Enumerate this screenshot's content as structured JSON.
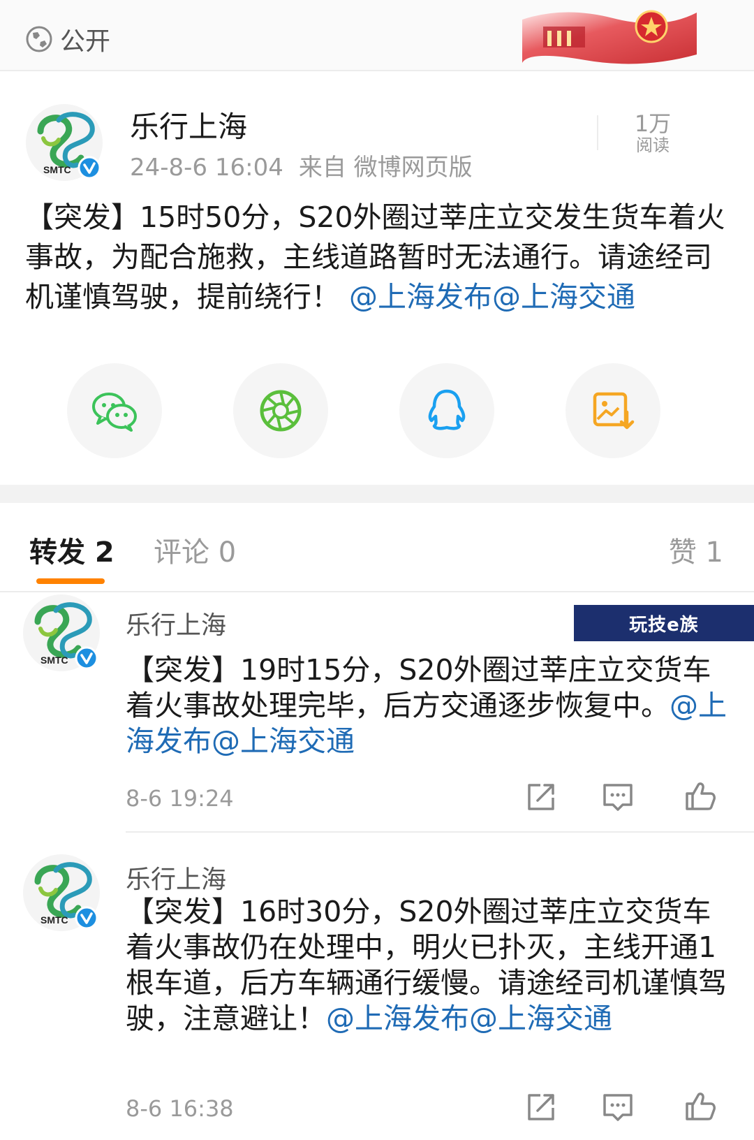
{
  "header": {
    "visibility_label": "公开",
    "visibility_icon": "globe-icon"
  },
  "post": {
    "author": "乐行上海",
    "avatar_text": "SMTC",
    "timestamp": "24-8-6 16:04",
    "source": "来自 微博网页版",
    "reads_count": "1万",
    "reads_label": "阅读",
    "text": "【突发】15时50分，S20外圈过莘庄立交发生货车着火事故，为配合施救，主线道路暂时无法通行。请途经司机谨慎驾驶，提前绕行！",
    "mentions": "@上海发布@上海交通"
  },
  "share_icons": [
    "wechat-icon",
    "moments-icon",
    "qq-icon",
    "save-image-icon"
  ],
  "tabs": {
    "repost": "转发 2",
    "comment": "评论 0",
    "like": "赞 1"
  },
  "watermark": "玩技e族",
  "replies": [
    {
      "author": "乐行上海",
      "avatar_text": "SMTC",
      "text": "【突发】19时15分，S20外圈过莘庄立交货车着火事故处理完毕，后方交通逐步恢复中。",
      "mentions": "@上海发布@上海交通",
      "time": "8-6 19:24"
    },
    {
      "author": "乐行上海",
      "avatar_text": "SMTC",
      "text": "【突发】16时30分，S20外圈过莘庄立交货车着火事故仍在处理中，明火已扑灭，主线开通1根车道，后方车辆通行缓慢。请途经司机谨慎驾驶，注意避让！",
      "mentions": "@上海发布@上海交通",
      "time": "8-6 16:38"
    }
  ],
  "colors": {
    "accent": "#ff8200",
    "mention": "#1f6bb5",
    "wechat": "#3cc35a",
    "qq": "#1aa0f0",
    "save": "#f5a623",
    "verified": "#1d8fe0"
  }
}
